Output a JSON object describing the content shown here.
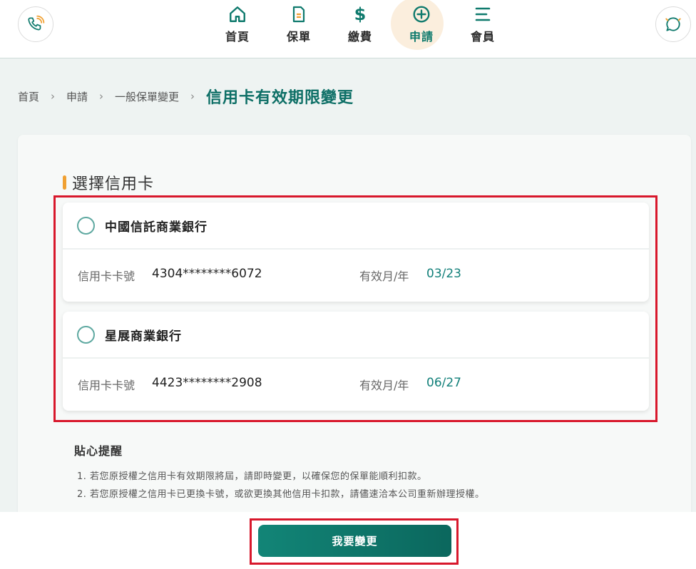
{
  "header": {
    "nav": [
      {
        "label": "首頁",
        "icon": "home-icon"
      },
      {
        "label": "保單",
        "icon": "document-icon"
      },
      {
        "label": "繳費",
        "icon": "dollar-icon"
      },
      {
        "label": "申請",
        "icon": "plus-circle-icon",
        "active": true
      },
      {
        "label": "會員",
        "icon": "menu-lines-icon"
      }
    ],
    "left_button_icon": "phone-call-icon",
    "right_button_icon": "chat-bubble-icon"
  },
  "breadcrumb": {
    "items": [
      "首頁",
      "申請",
      "一般保單變更"
    ],
    "current": "信用卡有效期限變更"
  },
  "section": {
    "title": "選擇信用卡"
  },
  "cards": [
    {
      "bank": "中國信託商業銀行",
      "number_label": "信用卡卡號",
      "number": "4304********6072",
      "expiry_label": "有效月/年",
      "expiry": "03/23"
    },
    {
      "bank": "星展商業銀行",
      "number_label": "信用卡卡號",
      "number": "4423********2908",
      "expiry_label": "有效月/年",
      "expiry": "06/27"
    }
  ],
  "tips": {
    "title": "貼心提醒",
    "items": [
      "1.  若您原授權之信用卡有效期限將屆，請即時變更，以確保您的保單能順利扣款。",
      "2.  若您原授權之信用卡已更換卡號，或欲更換其他信用卡扣款，請儘速洽本公司重新辦理授權。"
    ]
  },
  "submit_label": "我要變更",
  "colors": {
    "brand": "#0f7a6d",
    "accent": "#f0a032",
    "highlight": "#d8182c",
    "active_nav_bg": "#fbeedd"
  }
}
